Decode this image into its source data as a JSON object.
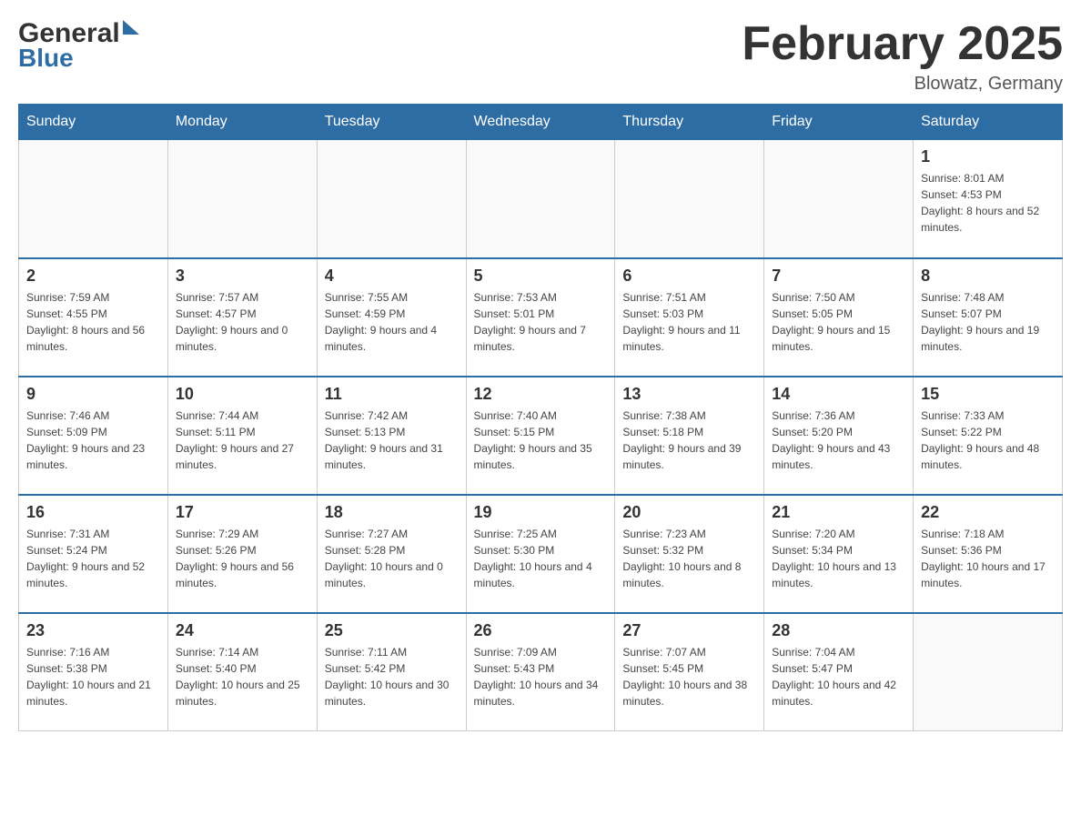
{
  "header": {
    "logo_general": "General",
    "logo_blue": "Blue",
    "month_title": "February 2025",
    "location": "Blowatz, Germany"
  },
  "weekdays": [
    "Sunday",
    "Monday",
    "Tuesday",
    "Wednesday",
    "Thursday",
    "Friday",
    "Saturday"
  ],
  "weeks": [
    [
      {
        "day": "",
        "info": ""
      },
      {
        "day": "",
        "info": ""
      },
      {
        "day": "",
        "info": ""
      },
      {
        "day": "",
        "info": ""
      },
      {
        "day": "",
        "info": ""
      },
      {
        "day": "",
        "info": ""
      },
      {
        "day": "1",
        "info": "Sunrise: 8:01 AM\nSunset: 4:53 PM\nDaylight: 8 hours and 52 minutes."
      }
    ],
    [
      {
        "day": "2",
        "info": "Sunrise: 7:59 AM\nSunset: 4:55 PM\nDaylight: 8 hours and 56 minutes."
      },
      {
        "day": "3",
        "info": "Sunrise: 7:57 AM\nSunset: 4:57 PM\nDaylight: 9 hours and 0 minutes."
      },
      {
        "day": "4",
        "info": "Sunrise: 7:55 AM\nSunset: 4:59 PM\nDaylight: 9 hours and 4 minutes."
      },
      {
        "day": "5",
        "info": "Sunrise: 7:53 AM\nSunset: 5:01 PM\nDaylight: 9 hours and 7 minutes."
      },
      {
        "day": "6",
        "info": "Sunrise: 7:51 AM\nSunset: 5:03 PM\nDaylight: 9 hours and 11 minutes."
      },
      {
        "day": "7",
        "info": "Sunrise: 7:50 AM\nSunset: 5:05 PM\nDaylight: 9 hours and 15 minutes."
      },
      {
        "day": "8",
        "info": "Sunrise: 7:48 AM\nSunset: 5:07 PM\nDaylight: 9 hours and 19 minutes."
      }
    ],
    [
      {
        "day": "9",
        "info": "Sunrise: 7:46 AM\nSunset: 5:09 PM\nDaylight: 9 hours and 23 minutes."
      },
      {
        "day": "10",
        "info": "Sunrise: 7:44 AM\nSunset: 5:11 PM\nDaylight: 9 hours and 27 minutes."
      },
      {
        "day": "11",
        "info": "Sunrise: 7:42 AM\nSunset: 5:13 PM\nDaylight: 9 hours and 31 minutes."
      },
      {
        "day": "12",
        "info": "Sunrise: 7:40 AM\nSunset: 5:15 PM\nDaylight: 9 hours and 35 minutes."
      },
      {
        "day": "13",
        "info": "Sunrise: 7:38 AM\nSunset: 5:18 PM\nDaylight: 9 hours and 39 minutes."
      },
      {
        "day": "14",
        "info": "Sunrise: 7:36 AM\nSunset: 5:20 PM\nDaylight: 9 hours and 43 minutes."
      },
      {
        "day": "15",
        "info": "Sunrise: 7:33 AM\nSunset: 5:22 PM\nDaylight: 9 hours and 48 minutes."
      }
    ],
    [
      {
        "day": "16",
        "info": "Sunrise: 7:31 AM\nSunset: 5:24 PM\nDaylight: 9 hours and 52 minutes."
      },
      {
        "day": "17",
        "info": "Sunrise: 7:29 AM\nSunset: 5:26 PM\nDaylight: 9 hours and 56 minutes."
      },
      {
        "day": "18",
        "info": "Sunrise: 7:27 AM\nSunset: 5:28 PM\nDaylight: 10 hours and 0 minutes."
      },
      {
        "day": "19",
        "info": "Sunrise: 7:25 AM\nSunset: 5:30 PM\nDaylight: 10 hours and 4 minutes."
      },
      {
        "day": "20",
        "info": "Sunrise: 7:23 AM\nSunset: 5:32 PM\nDaylight: 10 hours and 8 minutes."
      },
      {
        "day": "21",
        "info": "Sunrise: 7:20 AM\nSunset: 5:34 PM\nDaylight: 10 hours and 13 minutes."
      },
      {
        "day": "22",
        "info": "Sunrise: 7:18 AM\nSunset: 5:36 PM\nDaylight: 10 hours and 17 minutes."
      }
    ],
    [
      {
        "day": "23",
        "info": "Sunrise: 7:16 AM\nSunset: 5:38 PM\nDaylight: 10 hours and 21 minutes."
      },
      {
        "day": "24",
        "info": "Sunrise: 7:14 AM\nSunset: 5:40 PM\nDaylight: 10 hours and 25 minutes."
      },
      {
        "day": "25",
        "info": "Sunrise: 7:11 AM\nSunset: 5:42 PM\nDaylight: 10 hours and 30 minutes."
      },
      {
        "day": "26",
        "info": "Sunrise: 7:09 AM\nSunset: 5:43 PM\nDaylight: 10 hours and 34 minutes."
      },
      {
        "day": "27",
        "info": "Sunrise: 7:07 AM\nSunset: 5:45 PM\nDaylight: 10 hours and 38 minutes."
      },
      {
        "day": "28",
        "info": "Sunrise: 7:04 AM\nSunset: 5:47 PM\nDaylight: 10 hours and 42 minutes."
      },
      {
        "day": "",
        "info": ""
      }
    ]
  ]
}
